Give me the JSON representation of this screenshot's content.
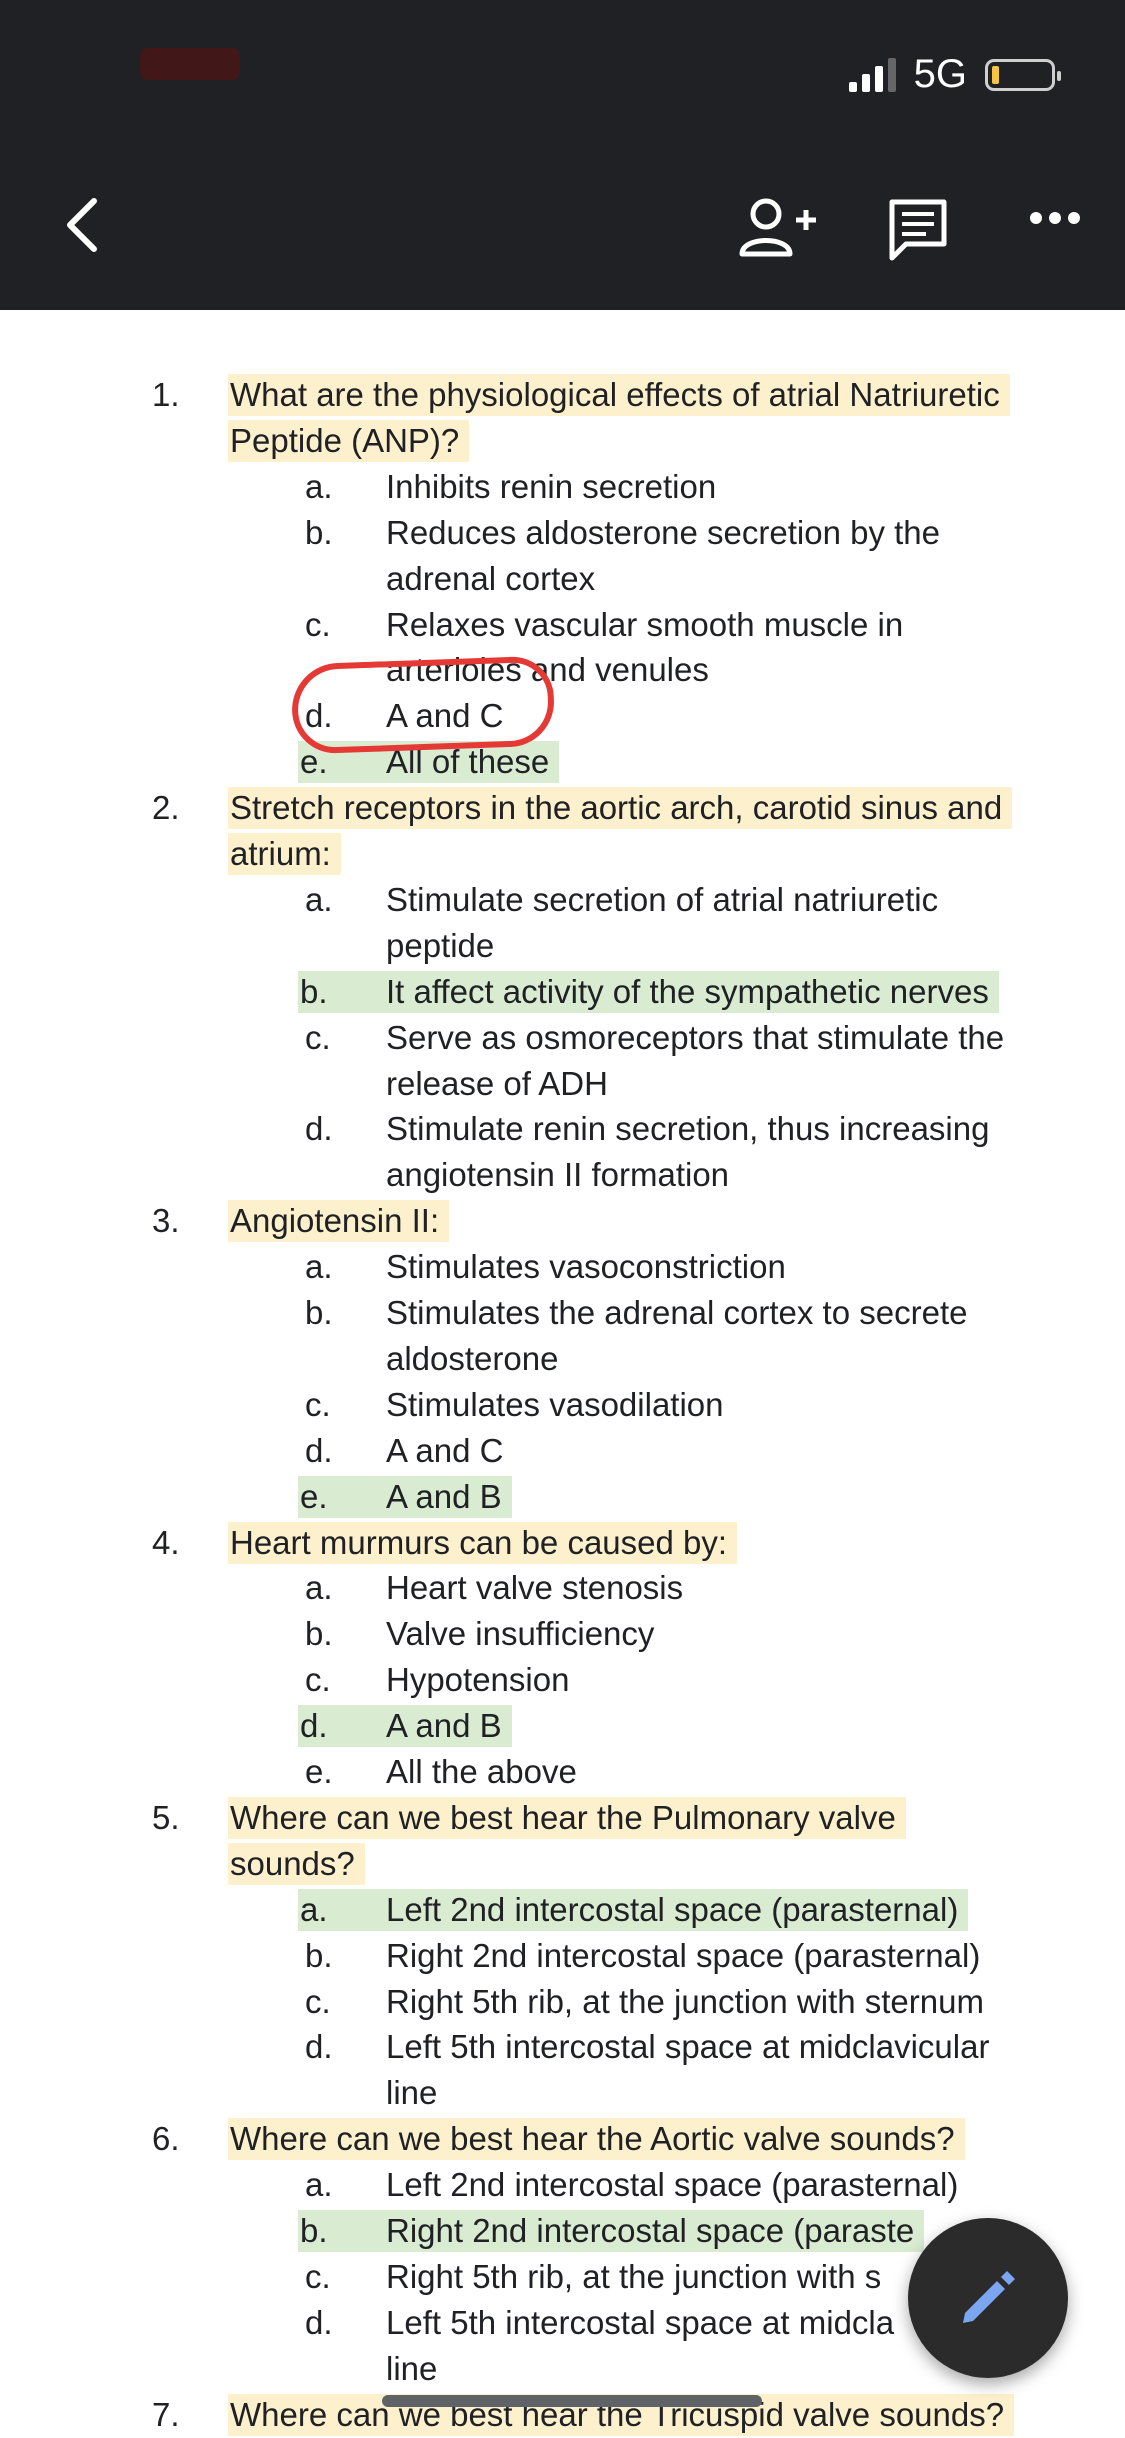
{
  "status_bar": {
    "network": "5G"
  },
  "toolbar": {
    "back_icon": "chevron-left-icon",
    "add_person_icon": "person-add-icon",
    "comment_icon": "comment-icon",
    "more_icon": "more-horiz-icon"
  },
  "colors": {
    "question_highlight": "#fdf0cc",
    "answer_highlight": "#d9ecd2",
    "annotation": "#e53935",
    "toolbar": "#202124"
  },
  "lines": [
    {
      "kind": "q",
      "num": "1.",
      "text": "What are the physiological effects of atrial Natriuretic",
      "hl": "yellow"
    },
    {
      "kind": "qc",
      "text": "Peptide (ANP)?",
      "hl": "yellow"
    },
    {
      "kind": "o",
      "letter": "a.",
      "text": "Inhibits renin secretion",
      "hl": ""
    },
    {
      "kind": "o",
      "letter": "b.",
      "text": "Reduces aldosterone secretion by the",
      "hl": ""
    },
    {
      "kind": "oc",
      "text": "adrenal cortex",
      "hl": ""
    },
    {
      "kind": "o",
      "letter": "c.",
      "text": "Relaxes vascular smooth muscle in",
      "hl": ""
    },
    {
      "kind": "oc",
      "text": "arterioles and venules",
      "hl": ""
    },
    {
      "kind": "o",
      "letter": "d.",
      "text": "A and C",
      "hl": ""
    },
    {
      "kind": "o",
      "letter": "e.",
      "text": "All of these",
      "hl": "green"
    },
    {
      "kind": "q",
      "num": "2.",
      "text": "Stretch receptors in the aortic arch, carotid sinus and",
      "hl": "yellow"
    },
    {
      "kind": "qc",
      "text": "atrium:",
      "hl": "yellow"
    },
    {
      "kind": "o",
      "letter": "a.",
      "text": "Stimulate secretion of atrial natriuretic",
      "hl": ""
    },
    {
      "kind": "oc",
      "text": "peptide",
      "hl": ""
    },
    {
      "kind": "o",
      "letter": "b.",
      "text": "It affect activity of the sympathetic nerves",
      "hl": "green"
    },
    {
      "kind": "o",
      "letter": "c.",
      "text": "Serve as osmoreceptors that stimulate the",
      "hl": ""
    },
    {
      "kind": "oc",
      "text": "release of ADH",
      "hl": ""
    },
    {
      "kind": "o",
      "letter": "d.",
      "text": "Stimulate renin secretion, thus increasing",
      "hl": ""
    },
    {
      "kind": "oc",
      "text": "angiotensin II formation",
      "hl": ""
    },
    {
      "kind": "q",
      "num": "3.",
      "text": "Angiotensin II:",
      "hl": "yellow"
    },
    {
      "kind": "o",
      "letter": "a.",
      "text": "Stimulates vasoconstriction",
      "hl": ""
    },
    {
      "kind": "o",
      "letter": "b.",
      "text": "Stimulates the adrenal cortex to secrete",
      "hl": ""
    },
    {
      "kind": "oc",
      "text": "aldosterone",
      "hl": ""
    },
    {
      "kind": "o",
      "letter": "c.",
      "text": "Stimulates vasodilation",
      "hl": ""
    },
    {
      "kind": "o",
      "letter": "d.",
      "text": "A and C",
      "hl": ""
    },
    {
      "kind": "o",
      "letter": "e.",
      "text": "A and B",
      "hl": "green"
    },
    {
      "kind": "q",
      "num": "4.",
      "text": "Heart murmurs can be caused by:",
      "hl": "yellow"
    },
    {
      "kind": "o",
      "letter": "a.",
      "text": "Heart valve stenosis",
      "hl": ""
    },
    {
      "kind": "o",
      "letter": "b.",
      "text": "Valve insufficiency",
      "hl": ""
    },
    {
      "kind": "o",
      "letter": "c.",
      "text": "Hypotension",
      "hl": ""
    },
    {
      "kind": "o",
      "letter": "d.",
      "text": "A and B",
      "hl": "green"
    },
    {
      "kind": "o",
      "letter": "e.",
      "text": "All the above",
      "hl": ""
    },
    {
      "kind": "q",
      "num": "5.",
      "text": "Where can we best hear the Pulmonary valve",
      "hl": "yellow"
    },
    {
      "kind": "qc",
      "text": "sounds?",
      "hl": "yellow"
    },
    {
      "kind": "o",
      "letter": "a.",
      "text": "Left 2nd intercostal space (parasternal)",
      "hl": "green"
    },
    {
      "kind": "o",
      "letter": "b.",
      "text": "Right 2nd intercostal space (parasternal)",
      "hl": ""
    },
    {
      "kind": "o",
      "letter": "c.",
      "text": "Right 5th rib, at the junction with sternum",
      "hl": ""
    },
    {
      "kind": "o",
      "letter": "d.",
      "text": "Left 5th intercostal space at midclavicular",
      "hl": ""
    },
    {
      "kind": "oc",
      "text": "line",
      "hl": ""
    },
    {
      "kind": "q",
      "num": "6.",
      "text": "Where can we best hear the Aortic valve sounds?",
      "hl": "yellow"
    },
    {
      "kind": "o",
      "letter": "a.",
      "text": "Left 2nd intercostal space (parasternal)",
      "hl": ""
    },
    {
      "kind": "o",
      "letter": "b.",
      "text": "Right 2nd intercostal space (paraste",
      "hl": "green"
    },
    {
      "kind": "o",
      "letter": "c.",
      "text": "Right 5th rib, at the junction with s",
      "hl": ""
    },
    {
      "kind": "o",
      "letter": "d.",
      "text": "Left 5th intercostal space at midcla",
      "hl": ""
    },
    {
      "kind": "oc",
      "text": "line",
      "hl": ""
    },
    {
      "kind": "q",
      "num": "7.",
      "text": "Where can we best hear the Tricuspid valve sounds?",
      "hl": "yellow"
    }
  ]
}
